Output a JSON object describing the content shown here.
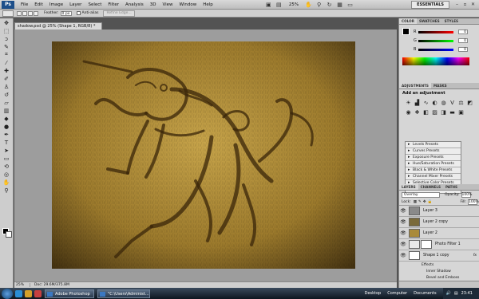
{
  "app": {
    "logo_text": "Ps",
    "menu": [
      "File",
      "Edit",
      "Image",
      "Layer",
      "Select",
      "Filter",
      "Analysis",
      "3D",
      "View",
      "Window",
      "Help"
    ],
    "zoom": "25%",
    "workspace": "ESSENTIALS",
    "window_buttons": [
      "–",
      "▫",
      "✕"
    ]
  },
  "options_bar": {
    "feather_label": "Feather:",
    "feather_value": "0 px",
    "anti_alias_label": "Anti-alias",
    "refine_label": "Refine Edge..."
  },
  "document": {
    "tab_title": "shadow.psd @ 25% (Shape 1, RGB/8) *",
    "status_zoom": "25%",
    "status_doc": "Doc: 29.6M/375.8M"
  },
  "color_panel": {
    "tabs": [
      "COLOR",
      "SWATCHES",
      "STYLES"
    ],
    "r_label": "R",
    "g_label": "G",
    "b_label": "B",
    "r_value": "0",
    "g_value": "0",
    "b_value": "0"
  },
  "adjustments_panel": {
    "tabs": [
      "ADJUSTMENTS",
      "MASKS"
    ],
    "title": "Add an adjustment",
    "icons": [
      "brightness-icon",
      "levels-icon",
      "curves-icon",
      "exposure-icon",
      "hue-sat-icon",
      "vibrance-icon",
      "color-balance-icon",
      "bw-icon",
      "photo-filter-icon",
      "channel-mixer-icon",
      "invert-icon",
      "posterize-icon",
      "threshold-icon",
      "gradient-map-icon",
      "selective-color-icon"
    ],
    "presets": [
      "Levels Presets",
      "Curves Presets",
      "Exposure Presets",
      "Hue/Saturation Presets",
      "Black & White Presets",
      "Channel Mixer Presets",
      "Selective Color Presets"
    ]
  },
  "layers_panel": {
    "tabs": [
      "LAYERS",
      "CHANNELS",
      "PATHS"
    ],
    "blend_mode": "Overlay",
    "opacity_label": "Opacity:",
    "opacity_value": "100%",
    "lock_label": "Lock:",
    "fill_label": "Fill:",
    "fill_value": "100%",
    "layers": [
      {
        "name": "Layer 3",
        "thumb": "#8a8a8a",
        "fx": ""
      },
      {
        "name": "Layer 2 copy",
        "thumb": "#7a6a3a",
        "fx": ""
      },
      {
        "name": "Layer 2",
        "thumb": "#a98a3a",
        "fx": ""
      },
      {
        "name": "Photo Filter 1",
        "thumb": "#e8e8e8",
        "fx": ""
      },
      {
        "name": "Shape 1 copy",
        "thumb": "#ffffff",
        "fx": "fx"
      }
    ],
    "effects": [
      "Effects",
      "Inner Shadow",
      "Bevel and Emboss"
    ]
  },
  "taskbar": {
    "tasks": [
      "Adobe Photoshop ...",
      "\"C:\\Users\\Administ..."
    ],
    "links": [
      "Desktop",
      "Computer",
      "Documents"
    ],
    "time": "23:41"
  }
}
